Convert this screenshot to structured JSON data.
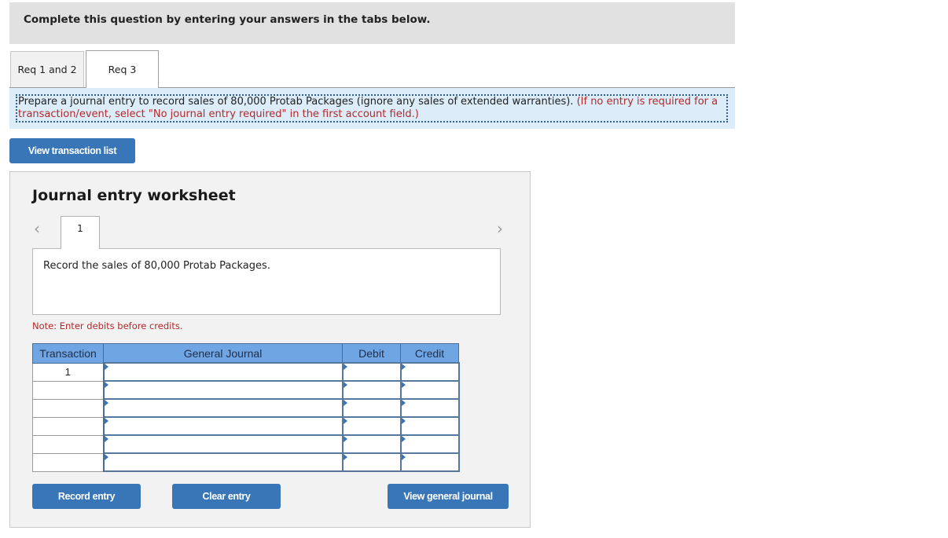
{
  "header": {
    "instructions": "Complete this question by entering your answers in the tabs below."
  },
  "tabs": [
    {
      "label": "Req 1 and 2",
      "active": false
    },
    {
      "label": "Req 3",
      "active": true
    }
  ],
  "prompt": {
    "text": "Prepare a journal entry to record sales of 80,000 Protab Packages (ignore any sales of extended warranties).",
    "note": "(If no entry is required for a transaction/event, select \"No journal entry required\" in the first account field.)"
  },
  "buttons": {
    "view_transaction_list": "View transaction list",
    "record_entry": "Record entry",
    "clear_entry": "Clear entry",
    "view_general_journal": "View general journal"
  },
  "worksheet": {
    "title": "Journal entry worksheet",
    "nav_prev_icon": "chevron-left",
    "nav_next_icon": "chevron-right",
    "entry_tab": "1",
    "description": "Record the sales of 80,000 Protab Packages.",
    "note": "Note: Enter debits before credits.",
    "table": {
      "headers": [
        "Transaction",
        "General Journal",
        "Debit",
        "Credit"
      ],
      "rows": [
        {
          "transaction": "1",
          "account": "",
          "debit": "",
          "credit": ""
        },
        {
          "transaction": "",
          "account": "",
          "debit": "",
          "credit": ""
        },
        {
          "transaction": "",
          "account": "",
          "debit": "",
          "credit": ""
        },
        {
          "transaction": "",
          "account": "",
          "debit": "",
          "credit": ""
        },
        {
          "transaction": "",
          "account": "",
          "debit": "",
          "credit": ""
        },
        {
          "transaction": "",
          "account": "",
          "debit": "",
          "credit": ""
        }
      ]
    }
  },
  "colors": {
    "button_blue": "#3876b8",
    "table_header": "#6fa5e3",
    "note_red": "#b22a2a",
    "prompt_bg": "#dcecf8"
  }
}
